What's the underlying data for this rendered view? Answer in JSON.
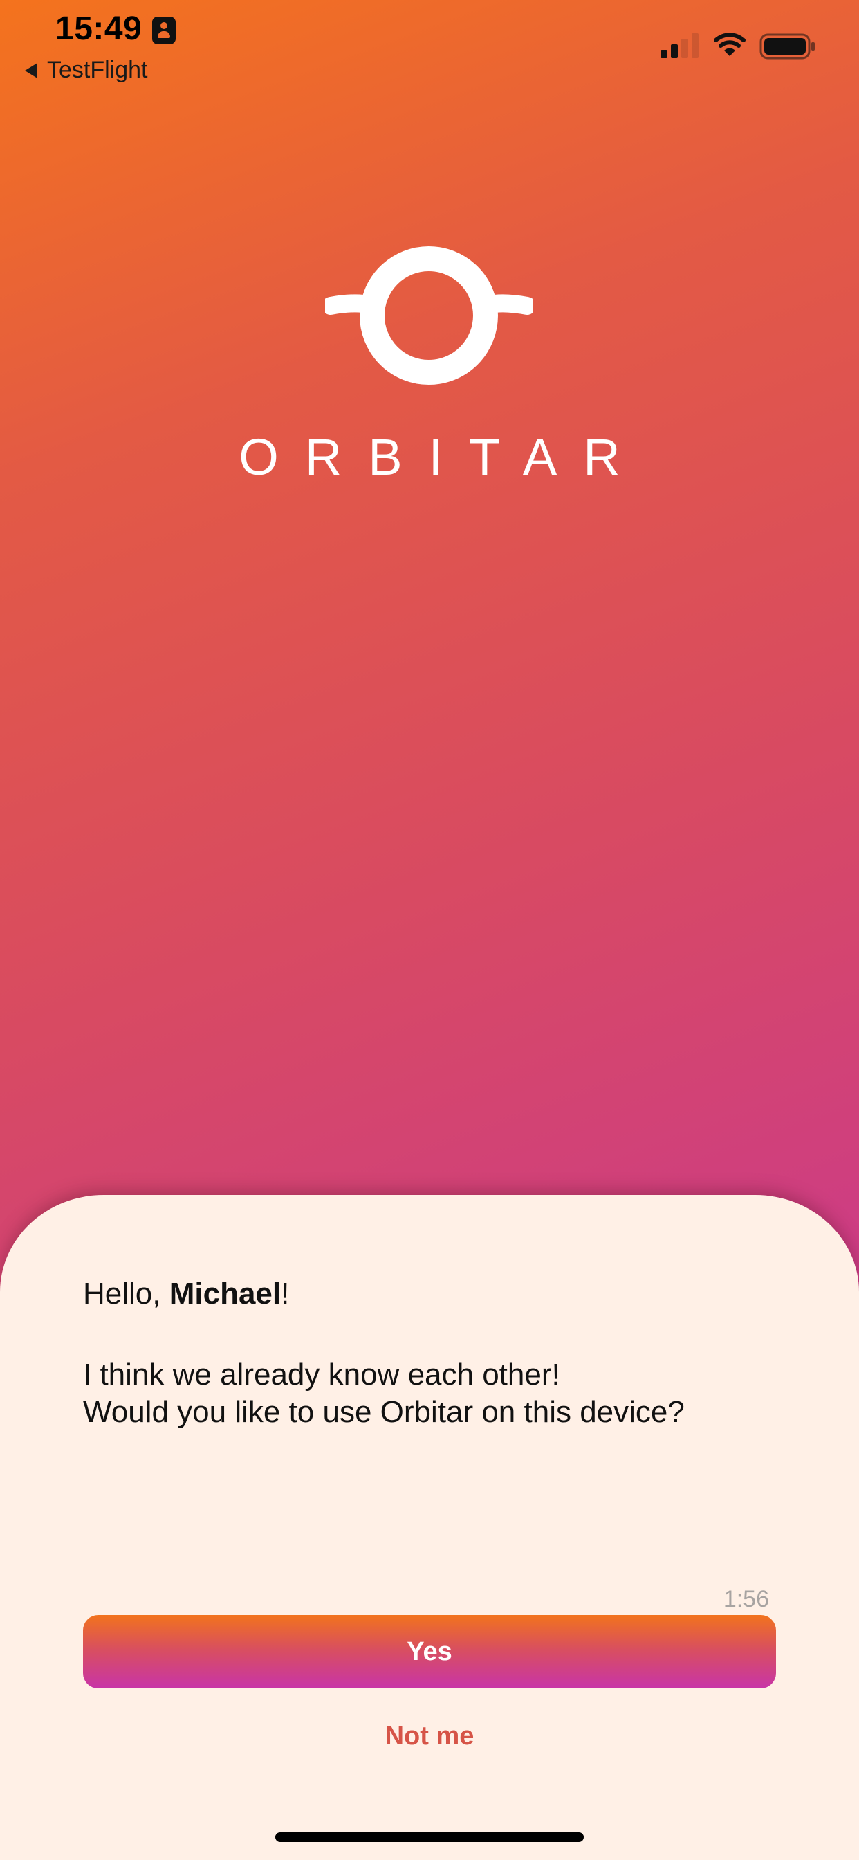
{
  "status_bar": {
    "time": "15:49",
    "back_label": "TestFlight"
  },
  "brand": {
    "name": "ORBITAR"
  },
  "sheet": {
    "greeting_prefix": "Hello, ",
    "user_name": "Michael",
    "greeting_suffix": "!",
    "message_line1": "I think we already know each other!",
    "message_line2": "Would you like to use Orbitar on this device?",
    "timer": "1:56",
    "yes_label": "Yes",
    "not_me_label": "Not me"
  },
  "colors": {
    "gradient_top": "#f4731d",
    "gradient_bottom": "#c42db3",
    "sheet_background": "#fff0e6",
    "accent_text": "#d65447"
  }
}
